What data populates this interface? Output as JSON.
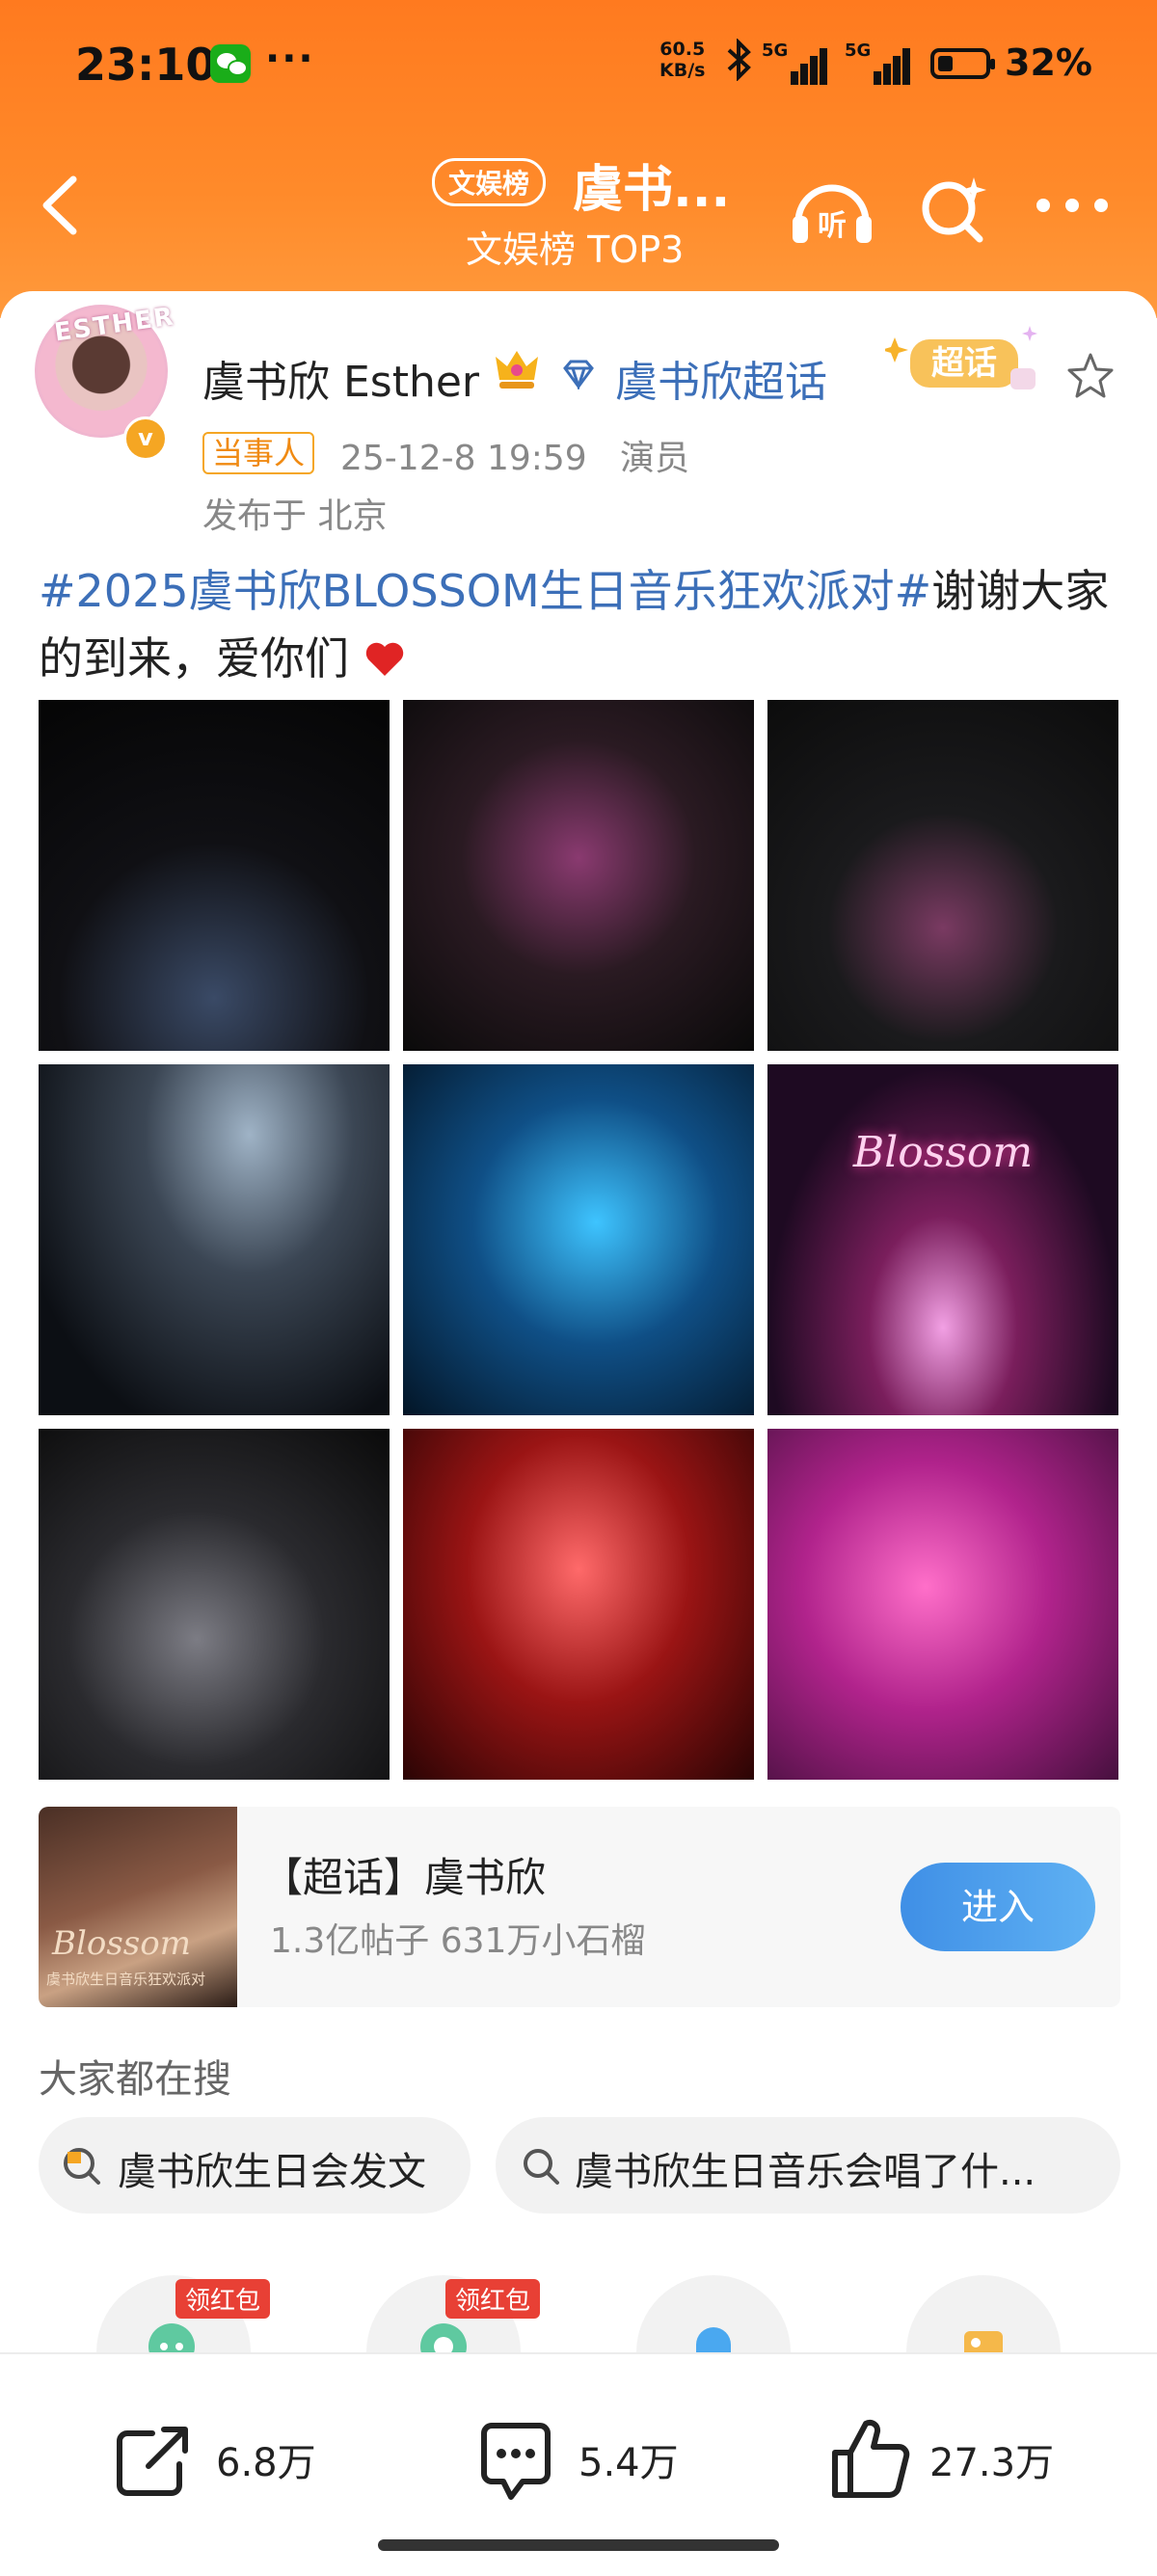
{
  "status_bar": {
    "time": "23:10",
    "more": "···",
    "net_speed_value": "60.5",
    "net_speed_unit": "KB/s",
    "sim1": "5G",
    "sim2": "5G",
    "battery_percent": "32%",
    "battery_level": 0.32
  },
  "nav": {
    "tag": "文娱榜",
    "title": "虞书...",
    "subtitle": "文娱榜 TOP3",
    "listen_label": "听"
  },
  "post": {
    "author": "虞书欣 Esther",
    "avatar_text": "ESTHER",
    "verified_badge": "v",
    "super_topic_link": "虞书欣超话",
    "chaohua_tag": "超话",
    "role_badge": "当事人",
    "datetime": "25-12-8 19:59",
    "profession": "演员",
    "location": "发布于 北京",
    "hashtag": "#2025虞书欣BLOSSOM生日音乐狂欢派对#",
    "text": "谢谢大家的到来，爱你们",
    "photo_labels": [
      "",
      "",
      "",
      "",
      "",
      "Blossom",
      "",
      "",
      ""
    ]
  },
  "super_topic_card": {
    "title": "【超话】虞书欣",
    "stats": "1.3亿帖子 631万小石榴",
    "enter_label": "进入",
    "thumb_text": "Blossom",
    "thumb_caption": "虞书欣生日音乐狂欢派对"
  },
  "search": {
    "title": "大家都在搜",
    "chips": [
      "虞书欣生日会发文",
      "虞书欣生日音乐会唱了什..."
    ]
  },
  "quick_icons": {
    "red_packet_label": "领红包"
  },
  "actions": {
    "share_count": "6.8万",
    "comment_count": "5.4万",
    "like_count": "27.3万"
  },
  "colors": {
    "header_orange": "#ff7a1f",
    "link_blue": "#3c6fb8",
    "role_orange": "#f08a12",
    "button_blue": "#4a9ced",
    "heart_red": "#e02424"
  }
}
